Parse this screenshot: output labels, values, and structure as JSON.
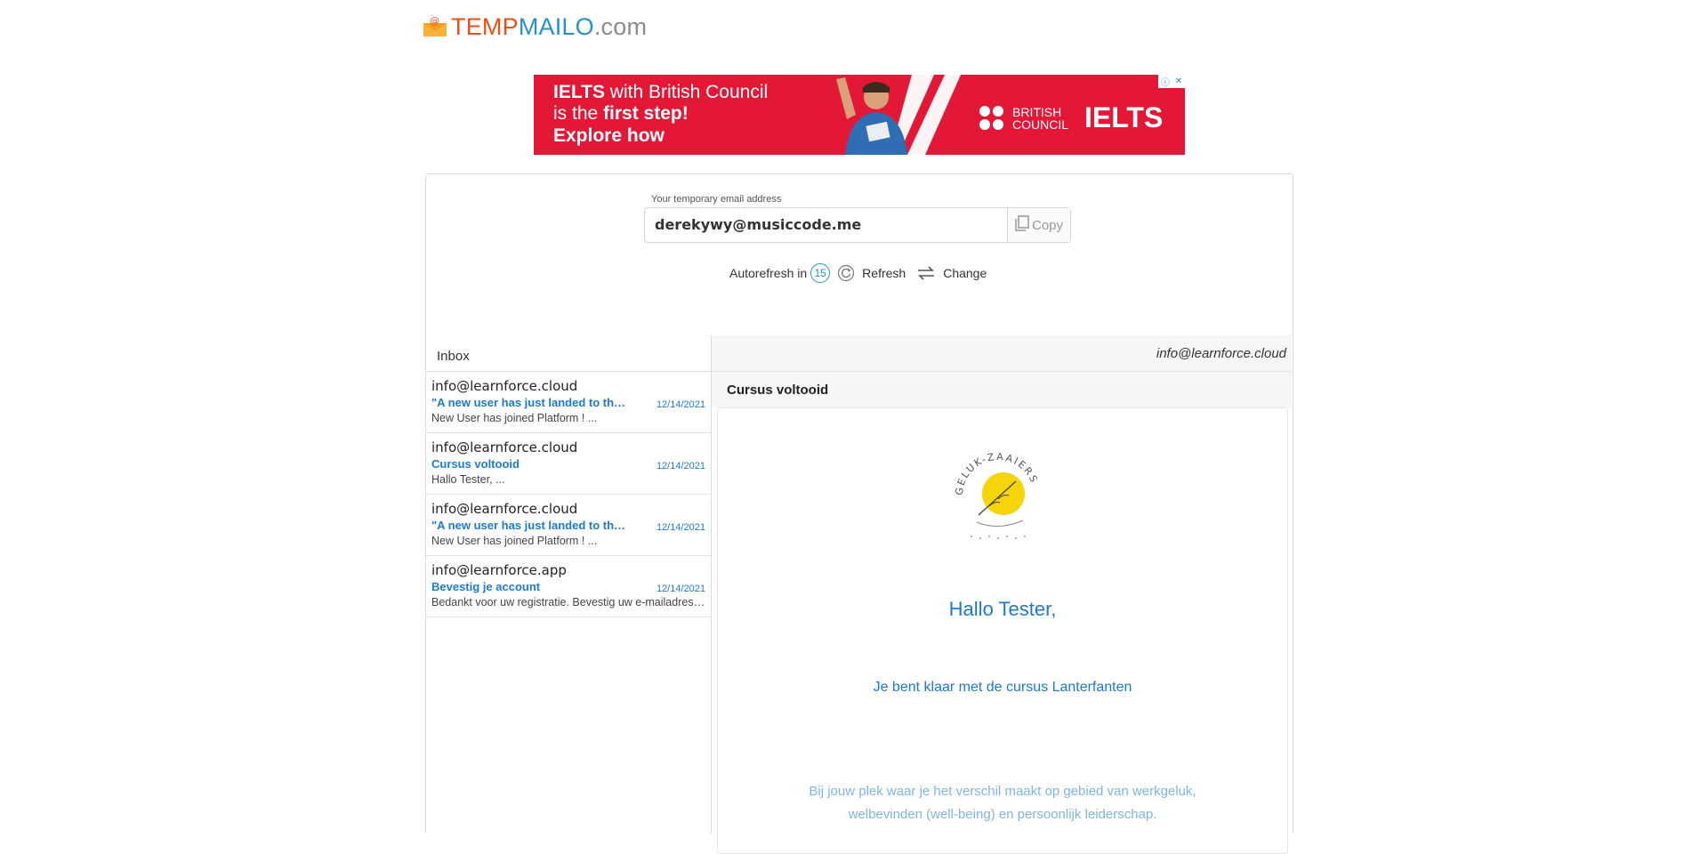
{
  "brand": {
    "part1": "TEMP",
    "part2": "MAILO",
    "part3": ".com"
  },
  "ad": {
    "line1_pre": "IELTS",
    "line1_post": " with British Council",
    "line2_pre": "is the ",
    "line2_bold": "first step!",
    "line3": "Explore how",
    "brand_top": "BRITISH",
    "brand_bottom": "COUNCIL",
    "brand_word": "IELTS"
  },
  "address": {
    "label": "Your temporary email address",
    "value": "derekywy@musiccode.me",
    "copy_label": "Copy"
  },
  "controls": {
    "autorefresh_label": "Autorefresh in",
    "countdown": "15",
    "refresh_label": "Refresh",
    "change_label": "Change"
  },
  "inbox": {
    "title": "Inbox",
    "messages": [
      {
        "from": "info@learnforce.cloud",
        "subject": "\"A new user has just landed to the platform\"",
        "date": "12/14/2021",
        "preview": "New User has joined Platform ! ..."
      },
      {
        "from": "info@learnforce.cloud",
        "subject": "Cursus voltooid",
        "date": "12/14/2021",
        "preview": "Hallo Tester, ..."
      },
      {
        "from": "info@learnforce.cloud",
        "subject": "\"A new user has just landed to the platform\"",
        "date": "12/14/2021",
        "preview": "New User has joined Platform ! ..."
      },
      {
        "from": "info@learnforce.app",
        "subject": "Bevestig je account",
        "date": "12/14/2021",
        "preview": "Bedankt voor uw registratie. Bevestig uw e-mailadres ..."
      }
    ]
  },
  "reader": {
    "from": "info@learnforce.cloud",
    "subject": "Cursus voltooid",
    "logo_text": "GELUK-ZAAIERS",
    "greeting": "Hallo Tester,",
    "message": "Je bent klaar met de cursus Lanterfanten",
    "mission_1": "Bij jouw plek waar je het verschil maakt op gebied van werkgeluk,",
    "mission_2": "welbevinden (well-being) en persoonlijk leiderschap."
  },
  "colors": {
    "accent": "#1c7ad0",
    "ad_red": "#e31837",
    "logo_orange": "#e8501b",
    "logo_blue": "#2a8fd0",
    "sun_yellow": "#f5d40a"
  }
}
